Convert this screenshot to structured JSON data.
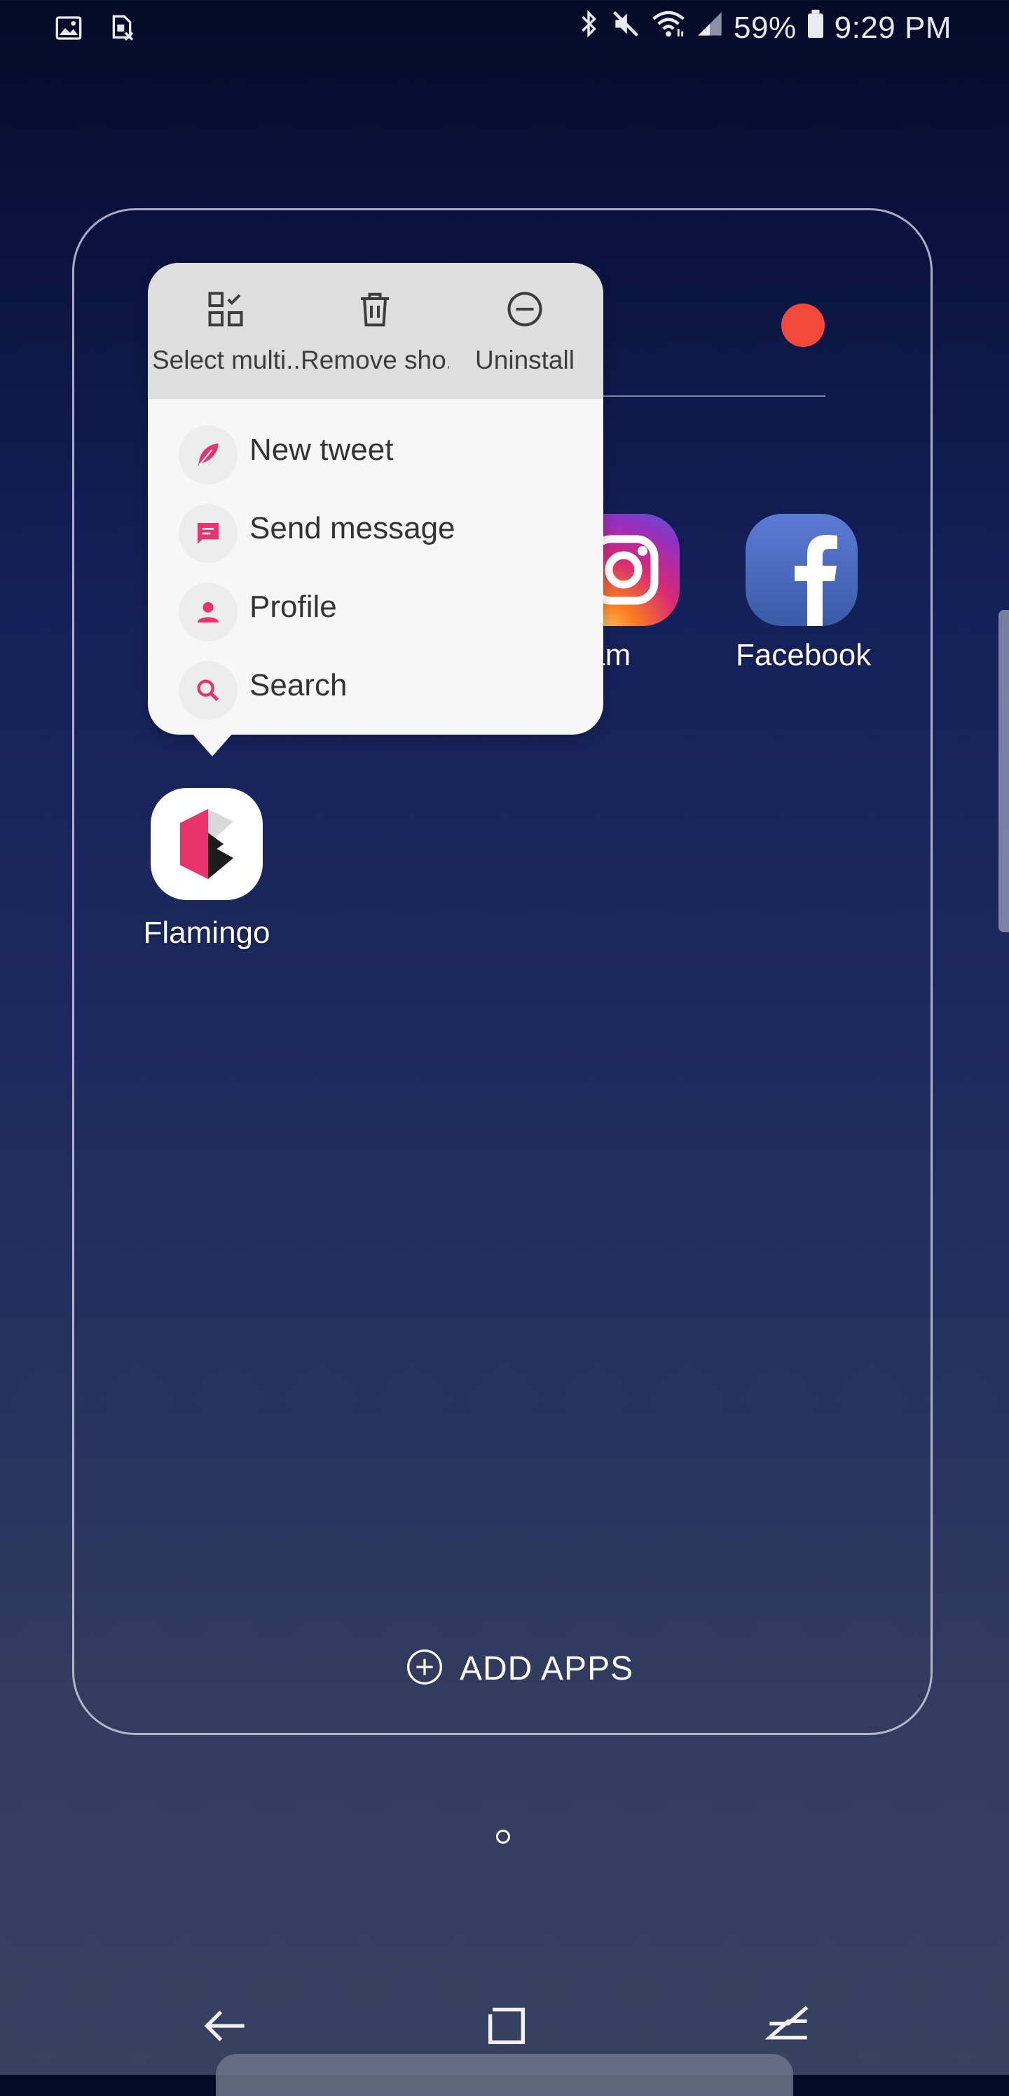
{
  "status_bar": {
    "left_icons": [
      "gallery-icon",
      "sim-card-off-icon"
    ],
    "right_icons": [
      "bluetooth-icon",
      "mute-icon",
      "wifi-icon",
      "signal-icon"
    ],
    "battery_percent": "59%",
    "time": "9:29 PM"
  },
  "folder": {
    "color_dot": "#f4483a",
    "add_apps_label": "ADD APPS"
  },
  "apps": {
    "instagram": {
      "label": "gram"
    },
    "facebook": {
      "label": "Facebook"
    },
    "flamingo": {
      "label": "Flamingo"
    }
  },
  "context_menu": {
    "actions": [
      {
        "label": "Select multi..",
        "icon": "select-multiple-icon"
      },
      {
        "label": "Remove sho..",
        "icon": "trash-icon"
      },
      {
        "label": "Uninstall",
        "icon": "uninstall-icon"
      }
    ],
    "shortcuts": [
      {
        "label": "New tweet",
        "icon": "feather-icon"
      },
      {
        "label": "Send message",
        "icon": "message-icon"
      },
      {
        "label": "Profile",
        "icon": "person-icon"
      },
      {
        "label": "Search",
        "icon": "search-icon"
      }
    ],
    "accent_color": "#e8336f"
  }
}
